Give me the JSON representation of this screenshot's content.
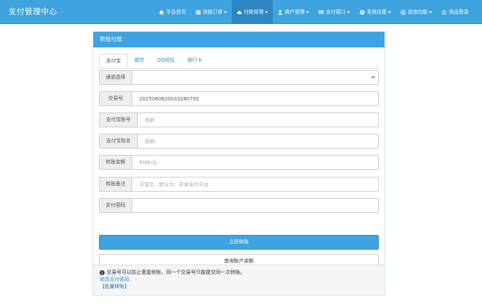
{
  "navbar": {
    "brand": "支付管理中心",
    "items": [
      {
        "label": "平台首页",
        "icon": "home-icon",
        "caret": false
      },
      {
        "label": "收款订单",
        "icon": "list-icon",
        "caret": true
      },
      {
        "label": "付款管理",
        "icon": "cloud-icon",
        "caret": true,
        "active": true
      },
      {
        "label": "商户管理",
        "icon": "user-icon",
        "caret": true
      },
      {
        "label": "支付接口",
        "icon": "card-icon",
        "caret": true
      },
      {
        "label": "系统设置",
        "icon": "gear-icon",
        "caret": true
      },
      {
        "label": "其他功能",
        "icon": "globe-icon",
        "caret": true
      },
      {
        "label": "退出登录",
        "icon": "power-icon",
        "caret": false
      }
    ]
  },
  "panel": {
    "title": "转账付款",
    "tabs": [
      "支付宝",
      "微信",
      "QQ钱包",
      "银行卡"
    ],
    "active_tab": 0,
    "channel": {
      "label": "通道选择",
      "value": ""
    },
    "trade_no": {
      "label": "交易号",
      "value": "2025080620033280792"
    },
    "account": {
      "label": "支付宝账号",
      "value": "",
      "placeholder": "放刷"
    },
    "name": {
      "label": "支付宝姓名",
      "value": "",
      "placeholder": "放刷"
    },
    "amount": {
      "label": "转账金额",
      "value": "",
      "placeholder": "RMB/元"
    },
    "remark": {
      "label": "转账备注",
      "value": "",
      "placeholder": "可留空，默认为：彩舍支付平台"
    },
    "password": {
      "label": "支付密码",
      "value": "",
      "placeholder": ""
    },
    "submit_label": "立即转账",
    "query_label": "查询账户余额"
  },
  "footer": {
    "note": "交易号可以防止重复转账，同一个交易号只能提交同一次转账。",
    "change_password": "修改支付密码",
    "batch_transfer": "【批量转账】"
  },
  "colors": {
    "primary": "#3ea3df",
    "active_nav": "#2e86c3",
    "link": "#3e8fd0"
  }
}
